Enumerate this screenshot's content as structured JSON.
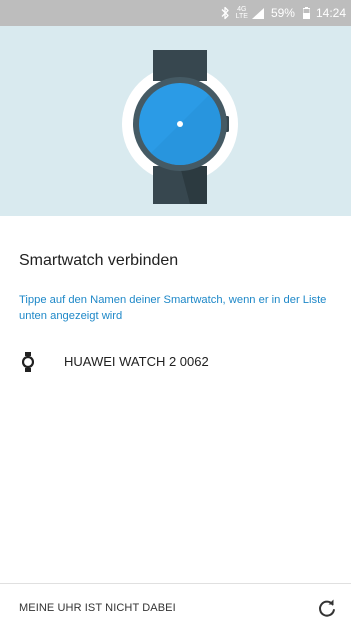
{
  "status_bar": {
    "network_type_top": "4G",
    "network_type_bottom": "LTE",
    "battery": "59%",
    "time": "14:24",
    "icons": [
      "bluetooth-icon",
      "signal-icon",
      "battery-icon"
    ]
  },
  "hero": {
    "illustration": "smartwatch-icon",
    "background_color": "#d9eaef",
    "watch_face_color": "#2b9be6",
    "watch_strap_color": "#37474f"
  },
  "main": {
    "title": "Smartwatch verbinden",
    "hint": "Tippe auf den Namen deiner Smartwatch, wenn er in der Liste unten angezeigt wird",
    "devices": [
      {
        "name": "HUAWEI WATCH 2 0062",
        "icon": "watch-icon"
      }
    ]
  },
  "footer": {
    "not_listed_label": "MEINE UHR IST NICHT DABEI",
    "refresh_icon": "refresh-icon"
  },
  "colors": {
    "accent": "#1e88c8",
    "status_bar": "#bdbdbd"
  }
}
